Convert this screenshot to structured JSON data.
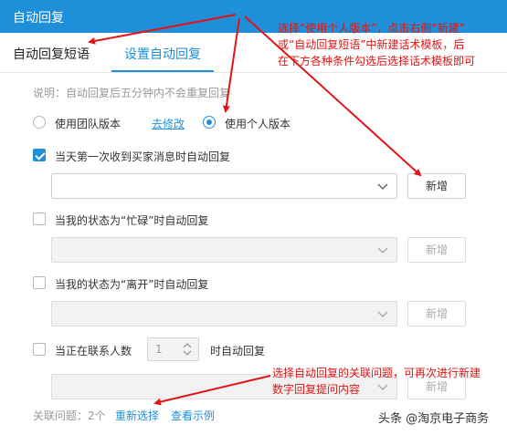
{
  "window": {
    "title": "自动回复"
  },
  "tabs": [
    {
      "label": "自动回复短语"
    },
    {
      "label": "设置自动回复"
    }
  ],
  "note": "说明：自动回复后五分钟内不会重复回复",
  "version": {
    "team_label": "使用团队版本",
    "modify_link": "去修改",
    "personal_label": "使用个人版本",
    "selected": "personal"
  },
  "rules": [
    {
      "label": "当天第一次收到买家消息时自动回复",
      "checked": true,
      "button": "新增",
      "enabled": true
    },
    {
      "label": "当我的状态为“忙碌”时自动回复",
      "checked": false,
      "button": "新增",
      "enabled": false
    },
    {
      "label": "当我的状态为“离开”时自动回复",
      "checked": false,
      "button": "新增",
      "enabled": false
    }
  ],
  "contacts_rule": {
    "prefix": "当正在联系人数",
    "value": "1",
    "suffix": "时自动回复",
    "checked": false,
    "button": "新增"
  },
  "related": {
    "label": "关联问题：2个",
    "reselect": "重新选择",
    "example": "查看示例"
  },
  "annotations": {
    "top_line1": "选择“使用个人版本”，点击右侧“新建”",
    "top_line2": "或“自动回复短语”中新建话术模板，后",
    "top_line3": "在下方各种条件勾选后选择话术模板即可",
    "bottom_line1": "选择自动回复的关联问题，可再次进行新建",
    "bottom_line2": "数字回复提问内容"
  },
  "watermark": "头条 @淘京电子商务",
  "colors": {
    "accent": "#1e8fd8",
    "annotation": "#e11515"
  }
}
